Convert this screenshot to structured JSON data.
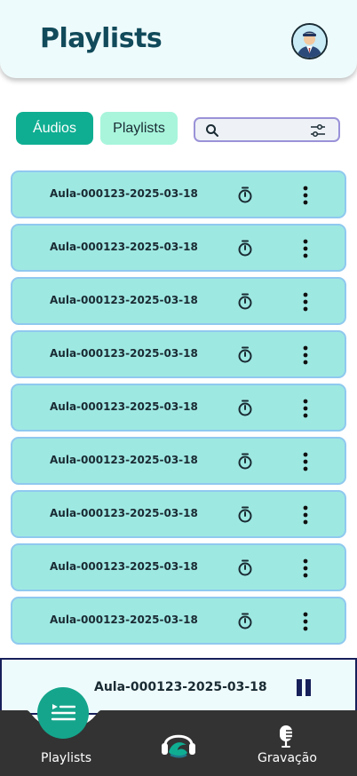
{
  "header": {
    "title": "Playlists",
    "avatar_icon": "user-avatar-icon"
  },
  "tabs": [
    {
      "label": "Áudios",
      "active": true
    },
    {
      "label": "Playlists",
      "active": false
    }
  ],
  "search": {
    "placeholder": "",
    "value": ""
  },
  "audio_list": [
    {
      "name": "Aula-000123-2025-03-18"
    },
    {
      "name": "Aula-000123-2025-03-18"
    },
    {
      "name": "Aula-000123-2025-03-18"
    },
    {
      "name": "Aula-000123-2025-03-18"
    },
    {
      "name": "Aula-000123-2025-03-18"
    },
    {
      "name": "Aula-000123-2025-03-18"
    },
    {
      "name": "Aula-000123-2025-03-18"
    },
    {
      "name": "Aula-000123-2025-03-18"
    },
    {
      "name": "Aula-000123-2025-03-18"
    }
  ],
  "player": {
    "track": "Aula-000123-2025-03-18",
    "state_icon": "pause-icon"
  },
  "bottom_nav": {
    "playlists_label": "Playlists",
    "gravacao_label": "Gravação"
  },
  "colors": {
    "accent": "#0fae92",
    "tab_inactive": "#a8f5dc",
    "row_bg": "#9ee8e2",
    "row_border": "#8fc9ef",
    "navbar": "#333333",
    "title": "#114a5a"
  }
}
